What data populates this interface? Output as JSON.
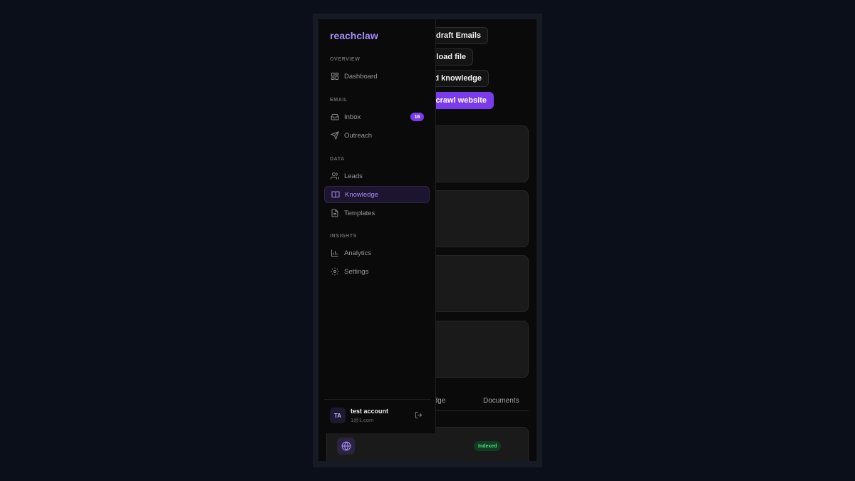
{
  "page": {
    "buttons": {
      "redraft": "e-draft Emails",
      "upload": "pload file",
      "add_knowledge": "dd knowledge",
      "recrawl": "e-crawl website"
    },
    "tabs": [
      "owledge",
      "Documents"
    ],
    "document": {
      "status": "Indexed",
      "icon": "globe-icon"
    }
  },
  "sidebar": {
    "logo": "reachclaw",
    "sections": {
      "overview": "OVERVIEW",
      "email": "EMAIL",
      "data": "DATA",
      "insights": "INSIGHTS"
    },
    "items": [
      {
        "label": "Dashboard",
        "icon": "dashboard-icon"
      },
      {
        "label": "Inbox",
        "icon": "inbox-icon",
        "badge": "16"
      },
      {
        "label": "Outreach",
        "icon": "send-icon"
      },
      {
        "label": "Leads",
        "icon": "users-icon"
      },
      {
        "label": "Knowledge",
        "icon": "book-icon",
        "active": true
      },
      {
        "label": "Templates",
        "icon": "file-text-icon"
      },
      {
        "label": "Analytics",
        "icon": "bar-chart-icon"
      },
      {
        "label": "Settings",
        "icon": "gear-icon"
      }
    ],
    "user": {
      "initials": "TA",
      "name": "test account",
      "email": "1@1.com"
    }
  },
  "colors": {
    "accent": "#7c3aed",
    "accent_text": "#a78bfa",
    "success": "#4ade80",
    "background": "#0b0f19"
  }
}
